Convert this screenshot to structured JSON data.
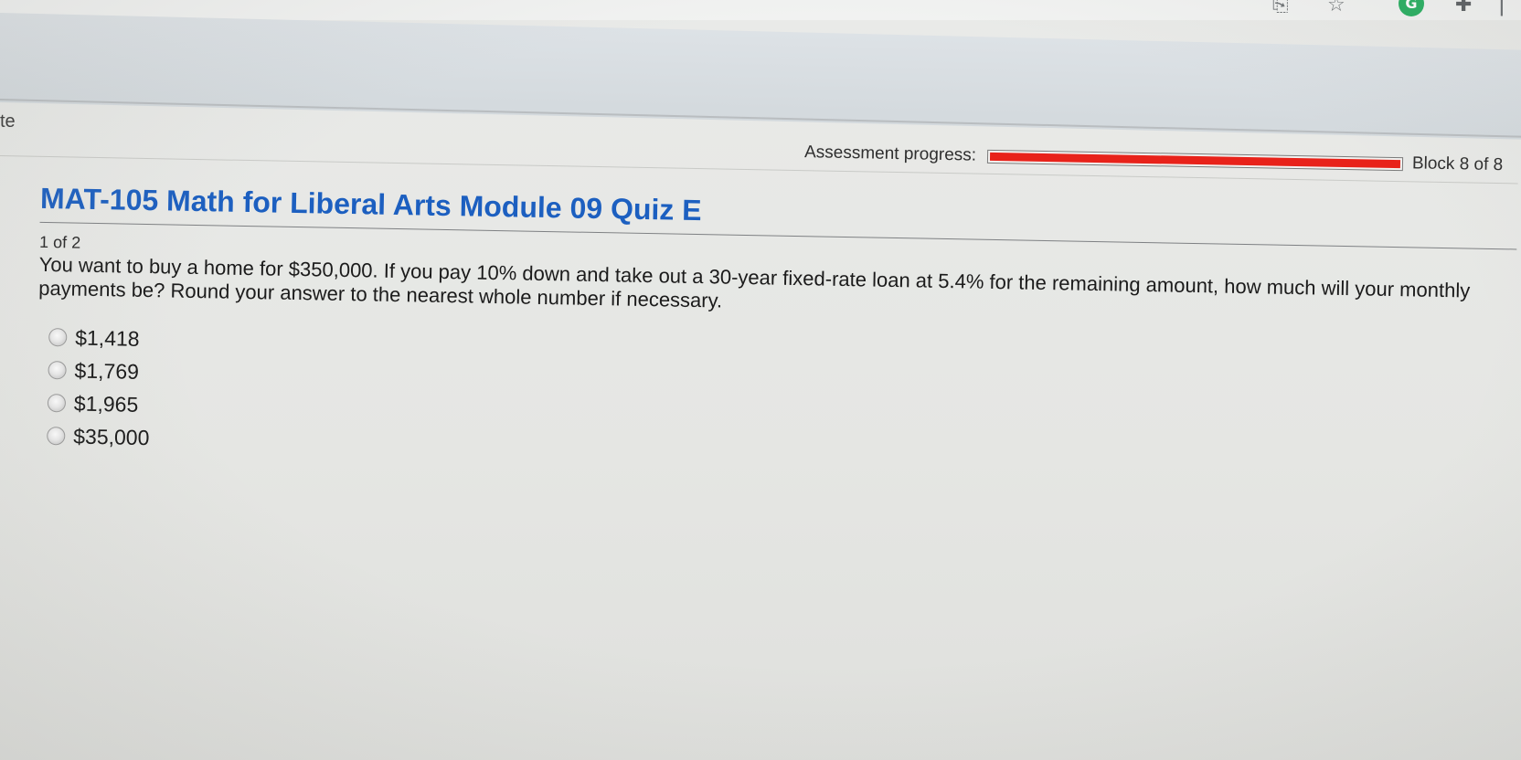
{
  "browser": {
    "icons": [
      "share-icon",
      "star-icon",
      "grammarly-icon",
      "extensions-icon",
      "profile-icon"
    ],
    "grammarly_letter": "G"
  },
  "left_fragment": "te",
  "assessment": {
    "progress_label": "Assessment progress:",
    "progress_value": 1.0,
    "block_label": "Block 8 of 8",
    "progress_color": "#e8221a"
  },
  "quiz": {
    "title": "MAT-105 Math for Liberal Arts Module 09 Quiz E",
    "title_color": "#1c5fc0",
    "question_counter": "1 of 2",
    "question_text": "You want to buy a home for $350,000. If you pay 10% down and take out a 30-year fixed-rate loan at 5.4% for the remaining amount, how much will your monthly payments be? Round your answer to the nearest whole number if necessary.",
    "options": [
      {
        "label": "$1,418"
      },
      {
        "label": "$1,769"
      },
      {
        "label": "$1,965"
      },
      {
        "label": "$35,000"
      }
    ]
  }
}
